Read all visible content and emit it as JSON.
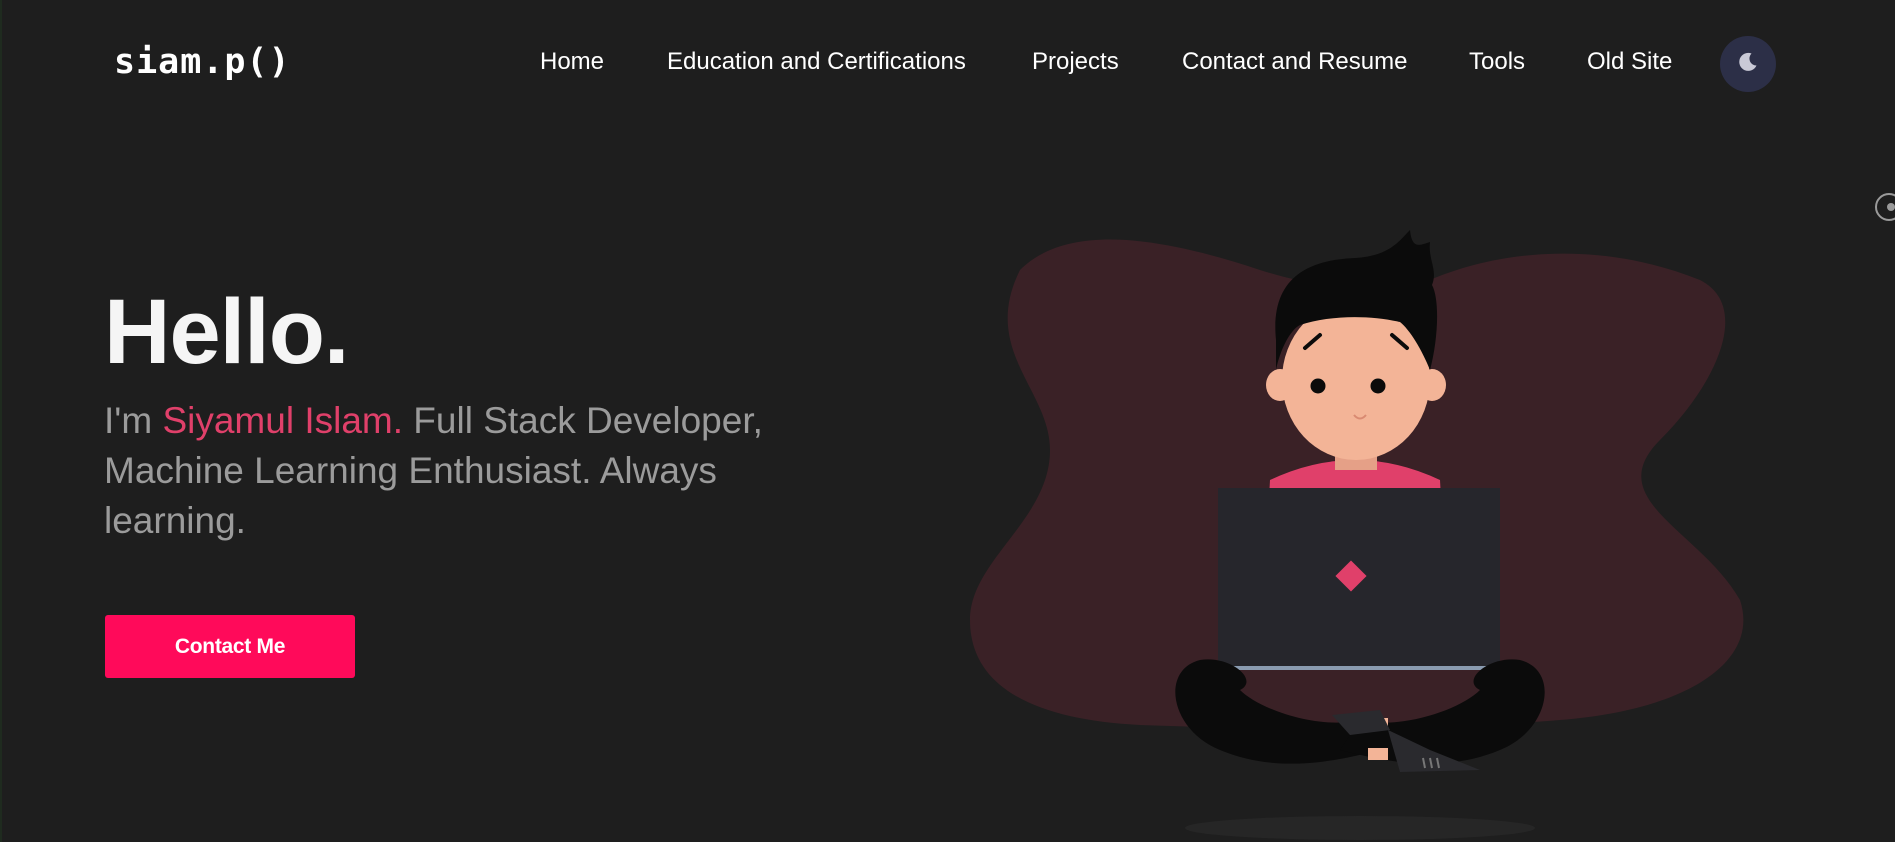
{
  "header": {
    "logo": "siam.p()",
    "nav": [
      {
        "label": "Home"
      },
      {
        "label": "Education and Certifications"
      },
      {
        "label": "Projects"
      },
      {
        "label": "Contact and Resume"
      },
      {
        "label": "Tools"
      },
      {
        "label": "Old Site"
      }
    ],
    "theme_toggle_icon": "moon-icon"
  },
  "hero": {
    "title": "Hello.",
    "intro_prefix": "I'm ",
    "name": "Siyamul Islam.",
    "intro_suffix": " Full Stack Developer, Machine Learning Enthusiast. Always learning.",
    "cta_label": "Contact Me"
  },
  "colors": {
    "background": "#1e1e1e",
    "accent": "#ff0a5a",
    "name_highlight": "#e0406a",
    "subtitle_text": "#9b9b9b",
    "blob": "#3a2126",
    "toggle_bg": "#2c2f47"
  },
  "illustration": {
    "icon": "developer-with-laptop-illustration"
  }
}
